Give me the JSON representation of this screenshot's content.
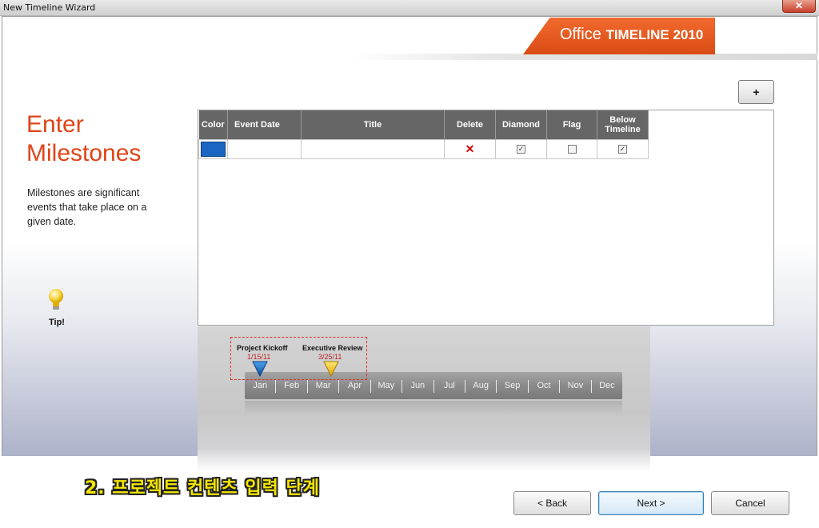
{
  "window": {
    "title": "New Timeline Wizard",
    "close_label": "✕"
  },
  "logo": {
    "office": "Office",
    "timeline": "TIMELINE 2010"
  },
  "step": {
    "heading": "Enter Milestones",
    "description": "Milestones are significant events that take place on a given date."
  },
  "tip": {
    "label": "Tip!"
  },
  "toolbar": {
    "add_label": "+"
  },
  "grid": {
    "columns": [
      "Color",
      "Event Date",
      "Title",
      "Delete",
      "Diamond",
      "Flag",
      "Below Timeline"
    ],
    "rows": [
      {
        "color": "#1a66c2",
        "event_date": "",
        "title": "",
        "delete": "✕",
        "diamond": "✓",
        "flag": "",
        "below": "✓"
      }
    ]
  },
  "preview": {
    "months": [
      "Jan",
      "Feb",
      "Mar",
      "Apr",
      "May",
      "Jun",
      "Jul",
      "Aug",
      "Sep",
      "Oct",
      "Nov",
      "Dec"
    ],
    "milestones": [
      {
        "title": "Project Kickoff",
        "date": "1/15/11",
        "color": "#1f6fc6"
      },
      {
        "title": "Executive Review",
        "date": "3/25/11",
        "color": "#f2c200"
      }
    ]
  },
  "annotation": {
    "text": "2. 프로젝트  컨텐츠 입력 단계"
  },
  "footer": {
    "back_label": "< Back",
    "next_label": "Next >",
    "cancel_label": "Cancel"
  },
  "colors": {
    "accent": "#e04418",
    "header_bg": "#666666",
    "selection_border": "#e0302a"
  }
}
